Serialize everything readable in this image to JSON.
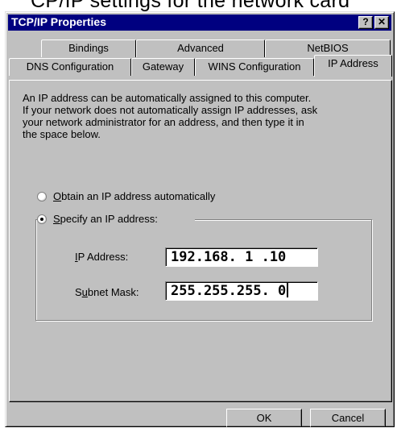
{
  "window": {
    "title": "TCP/IP Properties",
    "help_button": "?",
    "close_button": "✕"
  },
  "tabs_back": [
    {
      "label": "Bindings"
    },
    {
      "label": "Advanced"
    },
    {
      "label": "NetBIOS"
    }
  ],
  "tabs_front": [
    {
      "label": "DNS Configuration",
      "active": false
    },
    {
      "label": "Gateway",
      "active": false
    },
    {
      "label": "WINS Configuration",
      "active": false
    },
    {
      "label": "IP Address",
      "active": true
    }
  ],
  "description": {
    "line1": "An IP address can be automatically assigned to this computer.",
    "line2": "If your network does not automatically assign IP addresses, ask",
    "line3": "your network administrator for an address, and then type it in",
    "line4": "the space below."
  },
  "options": {
    "obtain": {
      "accel": "O",
      "rest": "btain an IP address automatically",
      "selected": false
    },
    "specify": {
      "accel": "S",
      "rest": "pecify an IP address:",
      "selected": true
    }
  },
  "fields": {
    "ip_address": {
      "label_accel": "I",
      "label_rest": "P Address:",
      "value": "192.168. 1 .10"
    },
    "subnet_mask": {
      "label_pre": "S",
      "label_accel": "u",
      "label_rest": "bnet Mask:",
      "value": "255.255.255. 0"
    }
  },
  "buttons": {
    "ok": "OK",
    "cancel": "Cancel"
  },
  "cut_off_text": "CP/IP settings for the network card"
}
